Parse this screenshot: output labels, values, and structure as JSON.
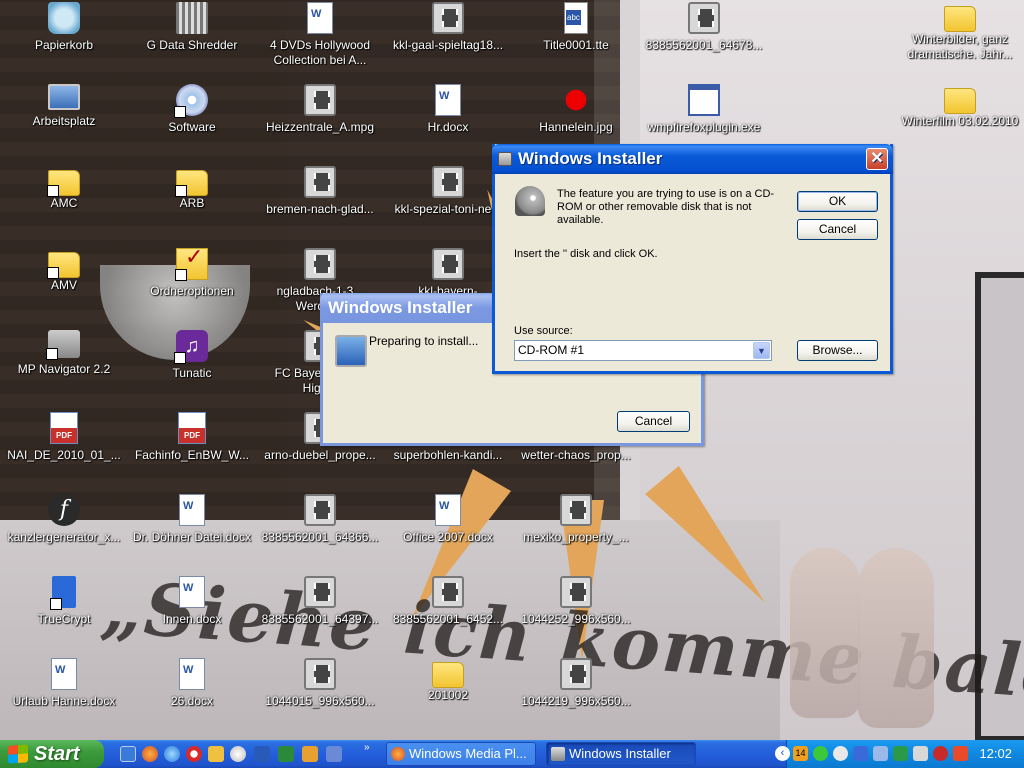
{
  "desktop": {
    "icons": [
      {
        "label": "Papierkorb",
        "icon": "recycle-bin-icon"
      },
      {
        "label": "G Data Shredder",
        "icon": "shredder-icon"
      },
      {
        "label": "4 DVDs Hollywood Collection bei A...",
        "icon": "word-document-icon"
      },
      {
        "label": "kkl-gaal-spieltag18...",
        "icon": "video-file-icon"
      },
      {
        "label": "Title0001.tte",
        "icon": "tte-file-icon"
      },
      {
        "label": "8385562001_64678...",
        "icon": "video-file-icon"
      },
      {
        "label": "Winterbilder, ganz dramatische. Jahr...",
        "icon": "folder-icon"
      },
      {
        "label": "Arbeitsplatz",
        "icon": "my-computer-icon"
      },
      {
        "label": "Software",
        "icon": "cd-software-icon"
      },
      {
        "label": "Heizzentrale_A.mpg",
        "icon": "video-file-icon"
      },
      {
        "label": "Hr.docx",
        "icon": "word-document-icon"
      },
      {
        "label": "Hannelein.jpg",
        "icon": "image-file-icon"
      },
      {
        "label": "wmpfirefoxplugin.exe",
        "icon": "executable-icon"
      },
      {
        "label": "Winterfilm 03.02.2010",
        "icon": "folder-icon"
      },
      {
        "label": "AMC",
        "icon": "folder-icon"
      },
      {
        "label": "ARB",
        "icon": "folder-icon"
      },
      {
        "label": "bremen-nach-glad...",
        "icon": "video-file-icon"
      },
      {
        "label": "kkl-spezial-toni-ne...",
        "icon": "video-file-icon"
      },
      {
        "label": "AMV",
        "icon": "folder-icon"
      },
      {
        "label": "Ordneroptionen",
        "icon": "folder-options-icon"
      },
      {
        "label": "ngladbach-1-3... Werder...",
        "icon": "video-file-icon"
      },
      {
        "label": "kkl-bayern-muenchen...",
        "icon": "video-file-icon"
      },
      {
        "label": "MP Navigator 2.2",
        "icon": "scanner-icon"
      },
      {
        "label": "Tunatic",
        "icon": "tunatic-icon"
      },
      {
        "label": "FC Bayern... 3_0 High...",
        "icon": "video-file-icon"
      },
      {
        "label": "NAI_DE_2010_01_...",
        "icon": "pdf-file-icon"
      },
      {
        "label": "Fachinfo_EnBW_W...",
        "icon": "pdf-file-icon"
      },
      {
        "label": "arno-duebel_prope...",
        "icon": "video-file-icon"
      },
      {
        "label": "superbohlen-kandi...",
        "icon": "video-file-icon"
      },
      {
        "label": "wetter-chaos_prop...",
        "icon": "video-file-icon"
      },
      {
        "label": "kanzlergenerator_x...",
        "icon": "flash-file-icon"
      },
      {
        "label": "Dr. Döhner Datei.docx",
        "icon": "word-document-icon"
      },
      {
        "label": "8385562001_64366...",
        "icon": "video-file-icon"
      },
      {
        "label": "Office 2007.docx",
        "icon": "word-document-icon"
      },
      {
        "label": "mexiko_property_...",
        "icon": "video-file-icon"
      },
      {
        "label": "TrueCrypt",
        "icon": "truecrypt-icon"
      },
      {
        "label": "Innen.docx",
        "icon": "word-document-icon"
      },
      {
        "label": "8385562001_64397...",
        "icon": "video-file-icon"
      },
      {
        "label": "8385562001_6452...",
        "icon": "video-file-icon"
      },
      {
        "label": "1044252_996x560...",
        "icon": "video-file-icon"
      },
      {
        "label": "Urlaub Hanne.docx",
        "icon": "word-document-icon"
      },
      {
        "label": "26.docx",
        "icon": "word-document-icon"
      },
      {
        "label": "1044015_996x560...",
        "icon": "video-file-icon"
      },
      {
        "label": "201002",
        "icon": "folder-icon"
      },
      {
        "label": "1044219_996x560...",
        "icon": "video-file-icon"
      }
    ],
    "wallpaper_text": "„Siehe ich komme bald!“"
  },
  "dialog_main": {
    "title": "Windows Installer",
    "message": "The feature you are trying to use is on a CD-ROM or other removable disk that is not available.",
    "instruction": "Insert the '' disk and click OK.",
    "use_source_label": "Use source:",
    "source_value": "CD-ROM #1",
    "ok_label": "OK",
    "cancel_label": "Cancel",
    "browse_label": "Browse...",
    "close_glyph": "✕"
  },
  "dialog_progress": {
    "title": "Windows Installer",
    "message": "Preparing to install...",
    "cancel_label": "Cancel"
  },
  "taskbar": {
    "start_label": "Start",
    "more_glyph": "»",
    "tasks": [
      {
        "label": "Windows Media Pl...",
        "icon": "firefox-icon"
      },
      {
        "label": "Windows Installer",
        "icon": "installer-icon"
      }
    ],
    "clock": "12:02",
    "tray_badge": "14",
    "expand_glyph": "‹"
  },
  "colors": {
    "titlebar_active": "#0a5ad8",
    "titlebar_inactive": "#7a96df",
    "dialog_face": "#ece9d8",
    "taskbar": "#245edb",
    "start_green": "#3c9b3c",
    "close_red": "#c8402a"
  }
}
